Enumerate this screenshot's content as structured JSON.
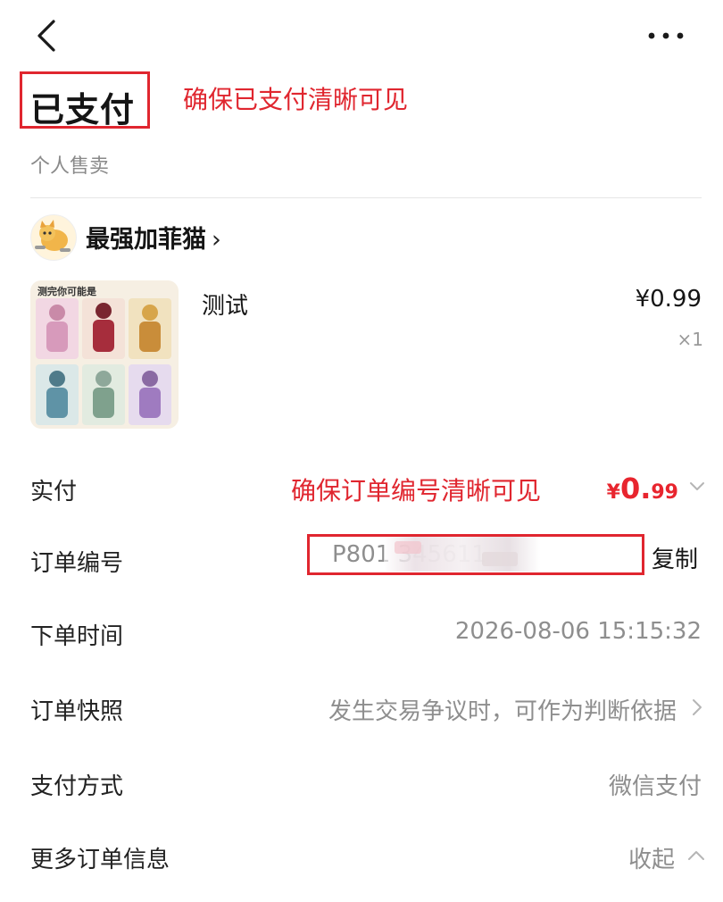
{
  "header": {
    "status_title": "已支付",
    "annotation_status": "确保已支付清晰可见",
    "subtitle": "个人售卖"
  },
  "seller": {
    "name": "最强加菲猫",
    "chevron": "›"
  },
  "product": {
    "thumb_caption": "测完你可能是",
    "name": "测试",
    "price": "¥0.99",
    "quantity": "×1"
  },
  "rows": {
    "paid": {
      "label": "实付",
      "currency": "¥",
      "amount_int": "0.",
      "amount_dec": "99",
      "annotation": "确保订单编号清晰可见"
    },
    "order_no": {
      "label": "订单编号",
      "value": "P801                   345611",
      "copy": "复制"
    },
    "order_time": {
      "label": "下单时间",
      "value": "2026-08-06 15:15:32"
    },
    "snapshot": {
      "label": "订单快照",
      "value": "发生交易争议时，可作为判断依据"
    },
    "pay_method": {
      "label": "支付方式",
      "value": "微信支付"
    },
    "more_info": {
      "label": "更多订单信息",
      "value": "收起"
    }
  },
  "icons": {
    "back": "chevron-left-icon",
    "more": "more-dots-icon",
    "expand": "chevron-down-icon",
    "collapse": "chevron-up-icon",
    "snapshot_arrow": "chevron-right-icon"
  },
  "colors": {
    "annotation_red": "#e0262f",
    "price_red": "#e8252e"
  }
}
